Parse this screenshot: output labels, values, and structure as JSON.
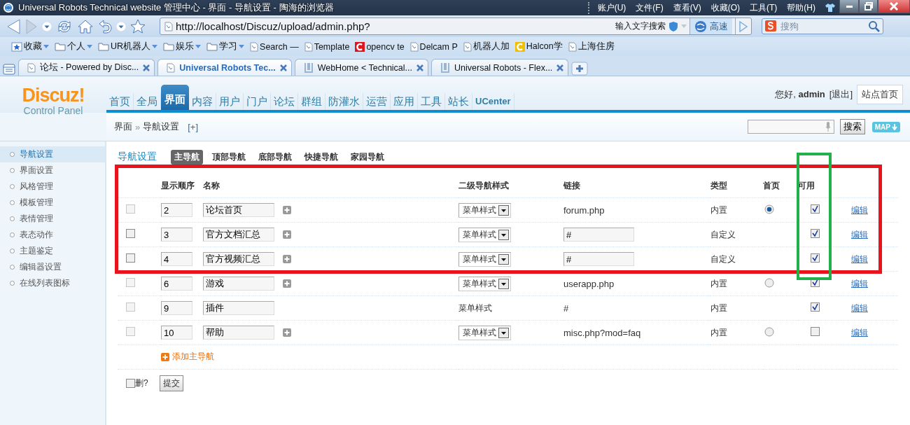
{
  "browser": {
    "title": "Universal Robots Technical website 管理中心 - 界面 - 导航设置 - 陶海的浏览器",
    "menu": [
      "账户(U)",
      "文件(F)",
      "查看(V)",
      "收藏(O)",
      "工具(T)",
      "帮助(H)"
    ],
    "address": "http://localhost/Discuz/upload/admin.php?",
    "search_hint": "输入文字搜索",
    "speed_button": "高速",
    "search_placeholder": "搜狗",
    "bookmarks": [
      {
        "label": "收藏",
        "kind": "favorites"
      },
      {
        "label": "个人",
        "kind": "folder"
      },
      {
        "label": "UR机器人",
        "kind": "folder"
      },
      {
        "label": "娱乐",
        "kind": "folder"
      },
      {
        "label": "学习",
        "kind": "folder"
      },
      {
        "label": "Search —",
        "kind": "page"
      },
      {
        "label": "Template",
        "kind": "page"
      },
      {
        "label": "opencv te",
        "kind": "logo",
        "color": "#e0141c"
      },
      {
        "label": "Delcam P",
        "kind": "page"
      },
      {
        "label": "机器人加",
        "kind": "page"
      },
      {
        "label": "Halcon学",
        "kind": "logo",
        "color": "#f0c000"
      },
      {
        "label": "上海住房",
        "kind": "page"
      }
    ],
    "tabs": [
      {
        "label": "论坛 - Powered by Disc...",
        "kind": "page",
        "selected": false
      },
      {
        "label": "Universal Robots Tec...",
        "kind": "page",
        "selected": true
      },
      {
        "label": "WebHome < Technical...",
        "kind": "logo",
        "selected": false
      },
      {
        "label": "Universal Robots - Flex...",
        "kind": "logo",
        "selected": false
      }
    ]
  },
  "header": {
    "logo": "Discuz!",
    "subtitle": "Control Panel",
    "nav": [
      {
        "label": "首页",
        "selected": false
      },
      {
        "label": "全局",
        "selected": false
      },
      {
        "label": "界面",
        "selected": true
      },
      {
        "label": "内容",
        "selected": false
      },
      {
        "label": "用户",
        "selected": false
      },
      {
        "label": "门户",
        "selected": false
      },
      {
        "label": "论坛",
        "selected": false
      },
      {
        "label": "群组",
        "selected": false
      },
      {
        "label": "防灌水",
        "selected": false
      },
      {
        "label": "运营",
        "selected": false
      },
      {
        "label": "应用",
        "selected": false
      },
      {
        "label": "工具",
        "selected": false
      },
      {
        "label": "站长",
        "selected": false
      },
      {
        "label": "UCenter",
        "selected": false
      }
    ],
    "greeting": "您好,",
    "user": "admin",
    "logout": "[退出]",
    "site_home": "站点首页"
  },
  "breadcrumb": {
    "items": [
      "界面",
      "导航设置"
    ],
    "separator": "»",
    "add": "[+]",
    "search_button": "搜索",
    "map_button": "MAP"
  },
  "sidebar": {
    "items": [
      {
        "label": "导航设置",
        "selected": true
      },
      {
        "label": "界面设置",
        "selected": false
      },
      {
        "label": "风格管理",
        "selected": false
      },
      {
        "label": "模板管理",
        "selected": false
      },
      {
        "label": "表情管理",
        "selected": false
      },
      {
        "label": "表态动作",
        "selected": false
      },
      {
        "label": "主题鉴定",
        "selected": false
      },
      {
        "label": "编辑器设置",
        "selected": false
      },
      {
        "label": "在线列表图标",
        "selected": false
      }
    ]
  },
  "content": {
    "title": "导航设置",
    "subtabs": [
      {
        "label": "主导航",
        "selected": true
      },
      {
        "label": "顶部导航",
        "selected": false
      },
      {
        "label": "底部导航",
        "selected": false
      },
      {
        "label": "快捷导航",
        "selected": false
      },
      {
        "label": "家园导航",
        "selected": false
      }
    ],
    "table": {
      "columns": [
        {
          "label": "显示顺序",
          "marked": false
        },
        {
          "label": "名称",
          "marked": false
        },
        {
          "label": "二级导航样式",
          "marked": false
        },
        {
          "label": "链接",
          "marked": false
        },
        {
          "label": "类型",
          "marked": false
        },
        {
          "label": "首页",
          "marked": false
        },
        {
          "label": "可用",
          "marked": true
        }
      ],
      "rows": [
        {
          "checked": false,
          "disabled": true,
          "order": "2",
          "name": "论坛首页",
          "add_child": true,
          "style": {
            "kind": "dropdown",
            "label": "菜单样式"
          },
          "link": {
            "kind": "text",
            "value": "forum.php"
          },
          "type": "内置",
          "home_radio": true,
          "home_selected": true,
          "enabled": true,
          "edit": "编辑",
          "marked": true
        },
        {
          "checked": false,
          "disabled": false,
          "order": "3",
          "name": "官方文档汇总",
          "add_child": true,
          "style": {
            "kind": "dropdown",
            "label": "菜单样式"
          },
          "link": {
            "kind": "field",
            "value": "#"
          },
          "type": "自定义",
          "home_radio": false,
          "enabled": true,
          "edit": "编辑",
          "marked": true
        },
        {
          "checked": false,
          "disabled": false,
          "order": "4",
          "name": "官方视频汇总",
          "add_child": true,
          "style": {
            "kind": "dropdown",
            "label": "菜单样式"
          },
          "link": {
            "kind": "field",
            "value": "#"
          },
          "type": "自定义",
          "home_radio": false,
          "enabled": true,
          "edit": "编辑",
          "marked": true
        },
        {
          "checked": false,
          "disabled": true,
          "order": "6",
          "name": "游戏",
          "add_child": true,
          "style": {
            "kind": "dropdown",
            "label": "菜单样式"
          },
          "link": {
            "kind": "text",
            "value": "userapp.php"
          },
          "type": "内置",
          "home_radio": true,
          "home_selected": false,
          "enabled": true,
          "edit": "编辑",
          "marked": false
        },
        {
          "checked": false,
          "disabled": true,
          "order": "9",
          "name": "插件",
          "add_child": false,
          "style": {
            "kind": "text",
            "label": "菜单样式"
          },
          "link": {
            "kind": "text",
            "value": "#"
          },
          "type": "内置",
          "home_radio": false,
          "enabled": true,
          "edit": "编辑",
          "marked": false
        },
        {
          "checked": false,
          "disabled": true,
          "order": "10",
          "name": "帮助",
          "add_child": true,
          "style": {
            "kind": "dropdown",
            "label": "菜单样式"
          },
          "link": {
            "kind": "text",
            "value": "misc.php?mod=faq"
          },
          "type": "内置",
          "home_radio": true,
          "home_selected": false,
          "enabled": false,
          "edit": "编辑",
          "marked": false
        }
      ],
      "add_link": "添加主导航",
      "delete_label": "删?",
      "delete_checked": false,
      "submit": "提交"
    },
    "highlights": [
      {
        "kind": "rows",
        "color": "#e8141c"
      },
      {
        "kind": "column",
        "color": "#22b04a"
      }
    ]
  }
}
